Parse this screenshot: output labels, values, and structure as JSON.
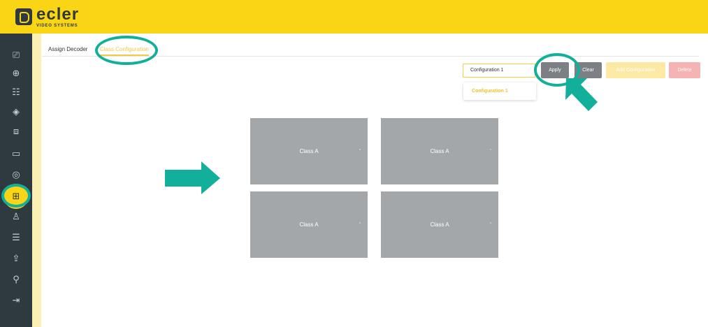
{
  "header": {
    "logo_word": "ecler",
    "logo_sub": "VIDEO SYSTEMS"
  },
  "sidebar": {
    "items": [
      {
        "icon": "monitor-search-icon",
        "glyph": "⎚",
        "active": false
      },
      {
        "icon": "plus-circle-icon",
        "glyph": "⊕",
        "active": false
      },
      {
        "icon": "grid-icon",
        "glyph": "☷",
        "active": false
      },
      {
        "icon": "layers-icon",
        "glyph": "◈",
        "active": false
      },
      {
        "icon": "display-icon",
        "glyph": "⧈",
        "active": false
      },
      {
        "icon": "screen-icon",
        "glyph": "▭",
        "active": false
      },
      {
        "icon": "target-icon",
        "glyph": "◎",
        "active": false
      },
      {
        "icon": "layout-icon",
        "glyph": "⊞",
        "active": true
      },
      {
        "icon": "user-icon",
        "glyph": "♙",
        "active": false
      },
      {
        "icon": "sliders-icon",
        "glyph": "☰",
        "active": false
      },
      {
        "icon": "upload-icon",
        "glyph": "⇪",
        "active": false
      },
      {
        "icon": "wrench-icon",
        "glyph": "⚲",
        "active": false
      },
      {
        "icon": "logout-icon",
        "glyph": "⇥",
        "active": false
      }
    ]
  },
  "tabs": {
    "assign_decoder": "Assign Decoder",
    "class_configuration": "Class Configuration"
  },
  "toolbar": {
    "select_value": "Configuration 1",
    "dropdown_option": "Configuration 1",
    "apply_label": "Apply",
    "clear_label": "Clear",
    "add_label": "Add Configuration",
    "delete_label": "Delete"
  },
  "grid": {
    "cells": [
      {
        "label": "Class A"
      },
      {
        "label": "Class A"
      },
      {
        "label": "Class A"
      },
      {
        "label": "Class A"
      }
    ]
  },
  "colors": {
    "brand_yellow": "#f9d516",
    "sidebar": "#2f3a40",
    "highlight_teal": "#12b09a",
    "cell_gray": "#a3a7aa"
  }
}
